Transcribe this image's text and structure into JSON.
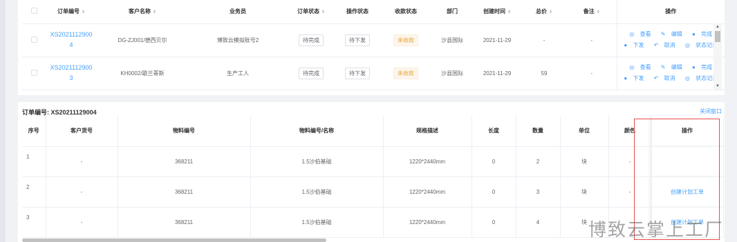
{
  "orders_table": {
    "headers": [
      "订单编号",
      "客户名称",
      "业务员",
      "订单状态",
      "操作状态",
      "收款状态",
      "部门",
      "创建时间",
      "总价",
      "备注",
      "操作"
    ],
    "rows": [
      {
        "order_no_line1": "XS2021112900",
        "order_no_line2": "4",
        "customer": "DG-ZJ001/德西贝尔",
        "salesman": "博致云模拟账号2",
        "order_status": "待完成",
        "op_status": "待下发",
        "pay_status": "未收款",
        "department": "沙县国际",
        "created": "2021-11-29",
        "total": "-",
        "remark": "-",
        "ops": [
          "查看",
          "编辑",
          "完成",
          "下发",
          "取消",
          "状态记录"
        ]
      },
      {
        "order_no_line1": "XS2021112900",
        "order_no_line2": "3",
        "customer": "KH0002/歌兰蒂斯",
        "salesman": "生产工人",
        "order_status": "待完成",
        "op_status": "待下发",
        "pay_status": "未收款",
        "department": "沙县国际",
        "created": "2021-11-29",
        "total": "59",
        "remark": "-",
        "ops": [
          "查看",
          "编辑",
          "完成",
          "下发",
          "取消",
          "状态记录"
        ]
      }
    ]
  },
  "detail": {
    "title_label": "订单编号:",
    "title_value": "XS20211129004",
    "close_label": "关闭窗口",
    "headers": [
      "序号",
      "客户货号",
      "物料编号",
      "物料编号/名称",
      "规格描述",
      "长度",
      "数量",
      "单位",
      "颜色",
      "操作"
    ],
    "rows": [
      {
        "idx": "1",
        "cust_no": "-",
        "material_no": "368211",
        "material_name": "1.5沙伯基础",
        "spec": "1220*2440mm",
        "length": "0",
        "qty": "2",
        "unit": "块",
        "color": "-",
        "action": ""
      },
      {
        "idx": "2",
        "cust_no": "-",
        "material_no": "368211",
        "material_name": "1.5沙伯基础",
        "spec": "1220*2440mm",
        "length": "0",
        "qty": "3",
        "unit": "块",
        "color": "-",
        "action": "创建计划工单"
      },
      {
        "idx": "3",
        "cust_no": "-",
        "material_no": "368211",
        "material_name": "1.5沙伯基础",
        "spec": "1220*2440mm",
        "length": "0",
        "qty": "4",
        "unit": "块",
        "color": "-",
        "action": "创建计划工单"
      }
    ]
  },
  "watermark": "博致云掌上工厂",
  "colors": {
    "link": "#409eff",
    "warning": "#e6a23c",
    "highlight_box": "#e84a4a"
  }
}
